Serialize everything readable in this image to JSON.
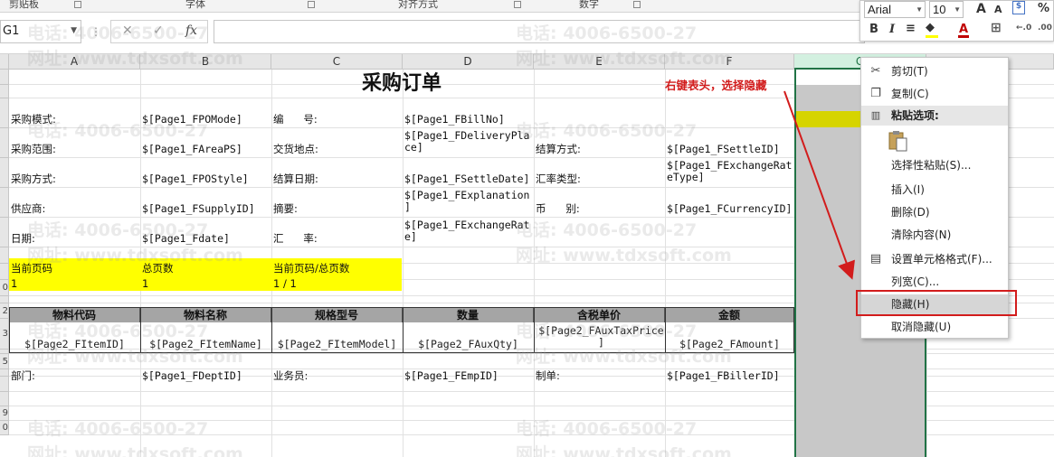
{
  "ribbon_groups": [
    "剪贴板",
    "字体",
    "对齐方式",
    "数字"
  ],
  "name_box": "G1",
  "formula_icons": {
    "more": "⋮",
    "cancel": "✕",
    "enter": "✓",
    "function": "fx"
  },
  "mini_toolbar": {
    "font": "Arial",
    "size": "10",
    "grow": "A",
    "shrink": "A",
    "percent": "%",
    "bold": "B",
    "italic": "I",
    "font_color_letter": "A",
    "decimals_more": "←.0",
    "decimals_less": ".00"
  },
  "columns": [
    "A",
    "B",
    "C",
    "D",
    "E",
    "F",
    "G",
    "H"
  ],
  "rows": [
    "",
    "",
    "",
    "",
    "",
    "",
    "",
    "",
    "",
    "0",
    "",
    "2",
    "3",
    "",
    "5",
    "",
    "",
    "",
    "9",
    "0"
  ],
  "sheet": {
    "title": "采购订单",
    "cells": [
      {
        "label_a": "采购模式:",
        "val_b": "$[Page1_FPOMode]",
        "label_c": "编      号:",
        "val_d": "$[Page1_FBillNo]",
        "label_e": "",
        "val_f": ""
      },
      {
        "label_a": "采购范围:",
        "val_b": "$[Page1_FAreaPS]",
        "label_c": "交货地点:",
        "val_d": "$[Page1_FDeliveryPla\nce]",
        "label_e": "结算方式:",
        "val_f": "$[Page1_FSettleID]"
      },
      {
        "label_a": "采购方式:",
        "val_b": "$[Page1_FPOStyle]",
        "label_c": "结算日期:",
        "val_d": "$[Page1_FSettleDate]",
        "label_e": "汇率类型:",
        "val_f": "$[Page1_FExchangeRat\neType]"
      },
      {
        "label_a": "供应商:",
        "val_b": "$[Page1_FSupplyID]",
        "label_c": "摘要:",
        "val_d": "$[Page1_FExplanation\n]",
        "label_e": "币      别:",
        "val_f": "$[Page1_FCurrencyID]"
      },
      {
        "label_a": "日期:",
        "val_b": "$[Page1_Fdate]",
        "label_c": "汇      率:",
        "val_d": "$[Page1_FExchangeRat\ne]",
        "label_e": "",
        "val_f": ""
      }
    ],
    "page_info": {
      "cur_label": "当前页码",
      "cur_val": "1",
      "total_label": "总页数",
      "total_val": "1",
      "ratio_label": "当前页码/总页数",
      "ratio_val": "1 / 1"
    },
    "table_headers": [
      "物料代码",
      "物料名称",
      "规格型号",
      "数量",
      "含税单价",
      "金额"
    ],
    "table_values": [
      "$[Page2_FItemID]",
      "$[Page2_FItemName]",
      "$[Page2_FItemModel]",
      "$[Page2_FAuxQty]",
      "$[Page2_FAuxTaxPrice\n]",
      "$[Page2_FAmount]"
    ],
    "footer": {
      "dept_label": "部门:",
      "dept_val": "$[Page1_FDeptID]",
      "emp_label": "业务员:",
      "emp_val": "$[Page1_FEmpID]",
      "biller_label": "制单:",
      "biller_val": "$[Page1_FBillerID]"
    }
  },
  "watermarks": {
    "phone": "电话: 4006-6500-27",
    "site": "网址: www.tdxsoft.com"
  },
  "annotation": "右键表头，选择隐藏",
  "context_menu": [
    {
      "label": "剪切(T)",
      "icon": "scissors-icon",
      "glyph": "✂"
    },
    {
      "label": "复制(C)",
      "icon": "copy-icon",
      "glyph": "❐"
    },
    {
      "label": "粘贴选项:",
      "icon": "paste-icon",
      "glyph": "📋",
      "header": true
    },
    {
      "label": "选择性粘贴(S)...",
      "icon": "",
      "glyph": ""
    },
    {
      "label": "插入(I)",
      "icon": "",
      "glyph": ""
    },
    {
      "label": "删除(D)",
      "icon": "",
      "glyph": ""
    },
    {
      "label": "清除内容(N)",
      "icon": "",
      "glyph": ""
    },
    {
      "label": "设置单元格格式(F)...",
      "icon": "format-cells-icon",
      "glyph": "▤"
    },
    {
      "label": "列宽(C)...",
      "icon": "",
      "glyph": ""
    },
    {
      "label": "隐藏(H)",
      "icon": "",
      "glyph": "",
      "hover": true
    },
    {
      "label": "取消隐藏(U)",
      "icon": "",
      "glyph": ""
    }
  ]
}
